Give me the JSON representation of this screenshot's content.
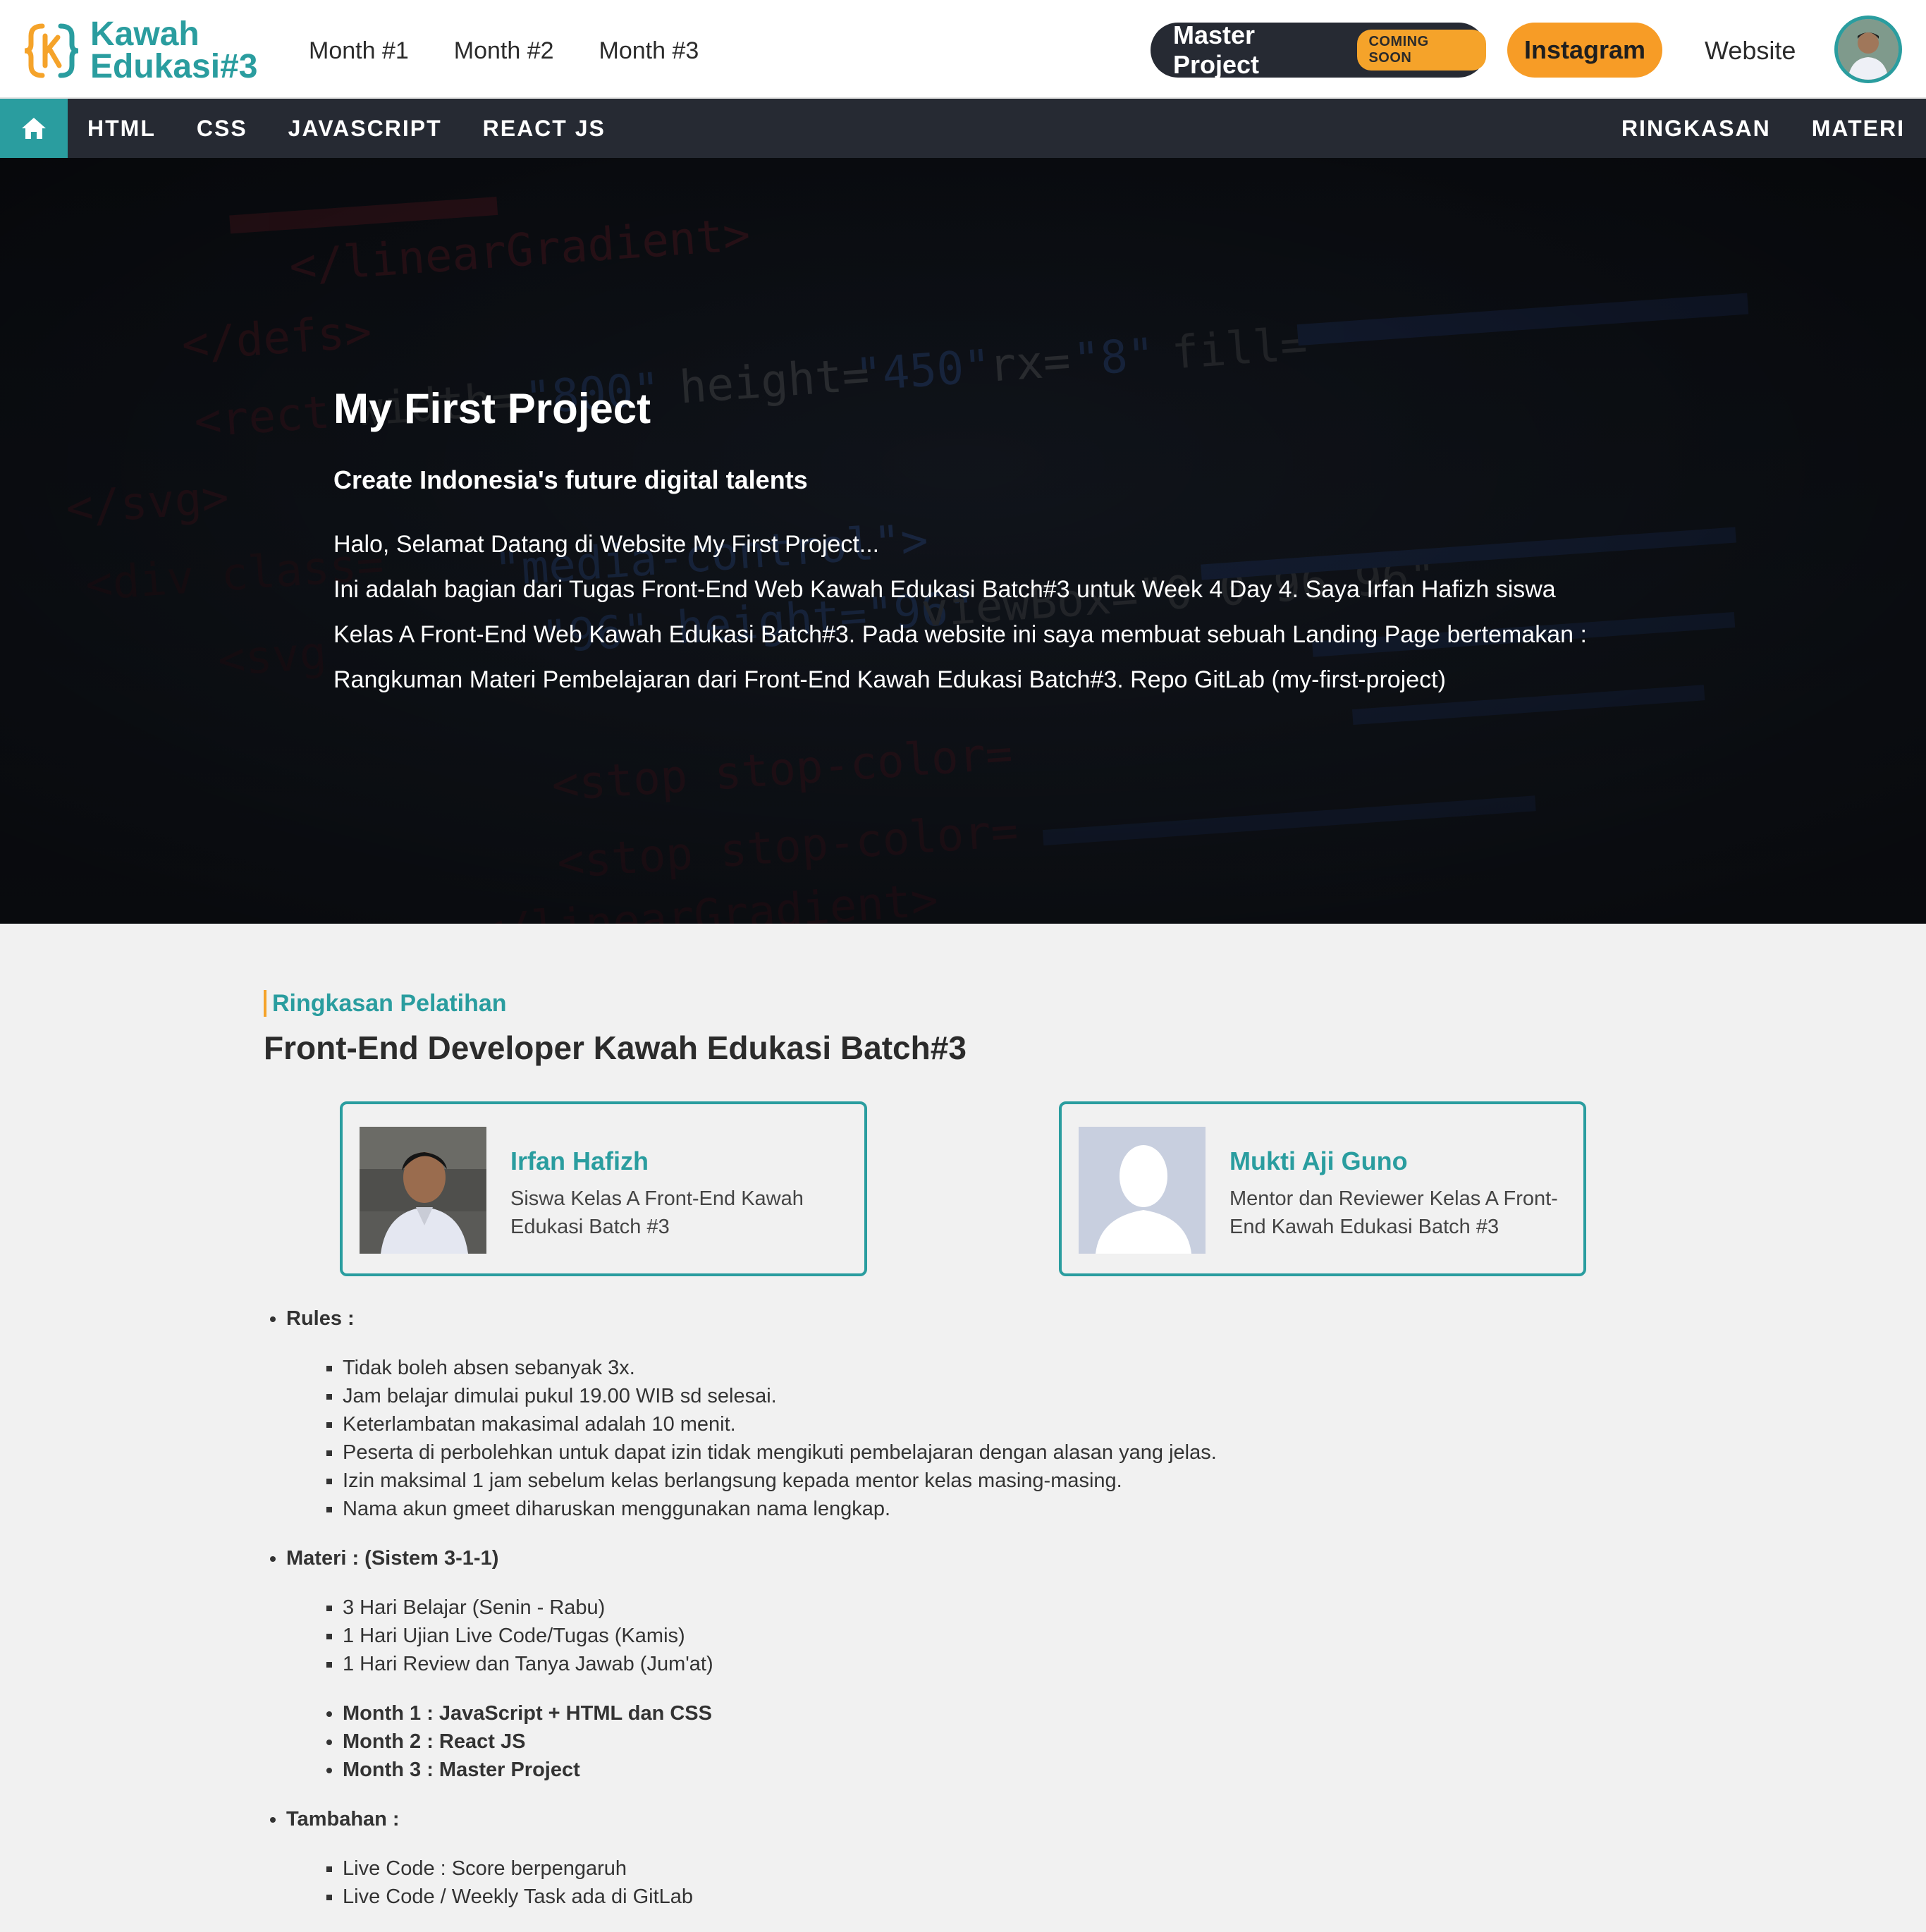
{
  "brand": {
    "line1": "Kawah",
    "line2": "Edukasi#3"
  },
  "top_nav": {
    "months": [
      "Month #1",
      "Month #2",
      "Month #3"
    ]
  },
  "master_project": {
    "label": "Master Project",
    "badge": "COMING SOON"
  },
  "instagram_label": "Instagram",
  "website_label": "Website",
  "sub_nav": {
    "left": [
      "HTML",
      "CSS",
      "JAVASCRIPT",
      "REACT JS"
    ],
    "right": [
      "RINGKASAN",
      "MATERI"
    ]
  },
  "hero": {
    "title": "My First Project",
    "subtitle": "Create Indonesia's future digital talents",
    "text": "Halo, Selamat Datang di Website My First Project... Ini adalah bagian dari Tugas Front-End Web Kawah Edukasi Batch#3 untuk Week 4 Day 4. Saya Irfan Hafizh siswa Kelas A Front-End Web Kawah Edukasi Batch#3. Pada website ini saya membuat sebuah Landing Page bertemakan : Rangkuman Materi Pembelajaran dari Front-End Kawah Edukasi Batch#3. Repo GitLab (my-first-project)",
    "text_lines": [
      "Halo, Selamat Datang di Website My First Project...",
      "Ini adalah bagian dari Tugas Front-End Web Kawah Edukasi Batch#3 untuk Week 4 Day 4. Saya Irfan Hafizh siswa",
      "Kelas A Front-End Web Kawah Edukasi Batch#3. Pada website ini saya membuat sebuah Landing Page bertemakan :",
      "Rangkuman Materi Pembelajaran dari Front-End Kawah Edukasi Batch#3. Repo GitLab (my-first-project)"
    ]
  },
  "summary": {
    "eyebrow": "Ringkasan Pelatihan",
    "title": "Front-End Developer Kawah Edukasi Batch#3",
    "people": [
      {
        "name": "Irfan Hafizh",
        "role": "Siswa Kelas A Front-End Kawah Edukasi Batch #3"
      },
      {
        "name": "Mukti Aji Guno",
        "role": "Mentor dan Reviewer Kelas A Front-End Kawah Edukasi Batch #3"
      }
    ]
  },
  "rules": {
    "heading": "Rules :",
    "items": [
      "Tidak boleh absen sebanyak 3x.",
      "Jam belajar dimulai pukul 19.00 WIB sd selesai.",
      "Keterlambatan makasimal adalah 10 menit.",
      "Peserta di perbolehkan untuk dapat izin tidak mengikuti pembelajaran dengan alasan yang jelas.",
      "Izin maksimal 1 jam sebelum kelas berlangsung kepada mentor kelas masing-masing.",
      "Nama akun gmeet diharuskan menggunakan nama lengkap."
    ]
  },
  "materi": {
    "heading": "Materi : (Sistem 3-1-1)",
    "items": [
      "3 Hari Belajar (Senin - Rabu)",
      "1 Hari Ujian Live Code/Tugas (Kamis)",
      "1 Hari Review dan Tanya Jawab (Jum'at)"
    ],
    "months": [
      "Month 1 : JavaScript + HTML dan CSS",
      "Month 2 : React JS",
      "Month 3 : Master Project"
    ]
  },
  "tambahan": {
    "heading": "Tambahan :",
    "items": [
      "Live Code : Score berpengaruh",
      "Live Code / Weekly Task ada di GitLab"
    ]
  },
  "colors": {
    "teal": "#2a9d9f",
    "orange": "#f79c26",
    "dark": "#262a33",
    "light_bg": "#f1f1f1"
  },
  "icons": {
    "home": "home-icon",
    "logo": "kawah-logo-icon"
  }
}
